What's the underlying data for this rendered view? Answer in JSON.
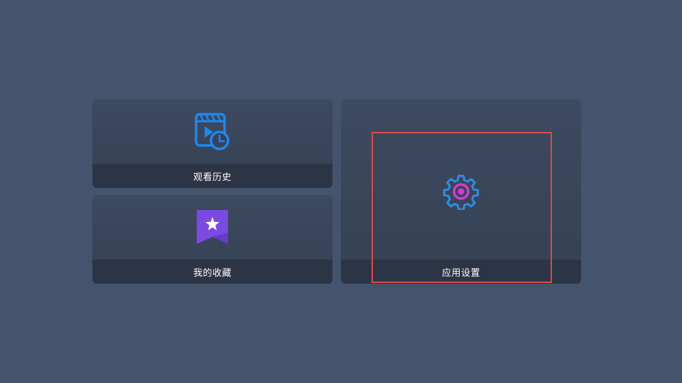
{
  "menu": {
    "history": {
      "label": "观看历史",
      "icon": "clapper-clock-icon"
    },
    "favorites": {
      "label": "我的收藏",
      "icon": "bookmark-star-icon"
    },
    "settings": {
      "label": "应用设置",
      "icon": "gear-icon"
    }
  },
  "focused_item": "settings",
  "colors": {
    "background": "#43546c",
    "focus_border": "#e0474c",
    "history_icon": "#1e88f0",
    "favorites_icon": "#7b4ae2",
    "settings_icon_outer": "#2f8de4",
    "settings_icon_inner": "#d63cd0"
  }
}
